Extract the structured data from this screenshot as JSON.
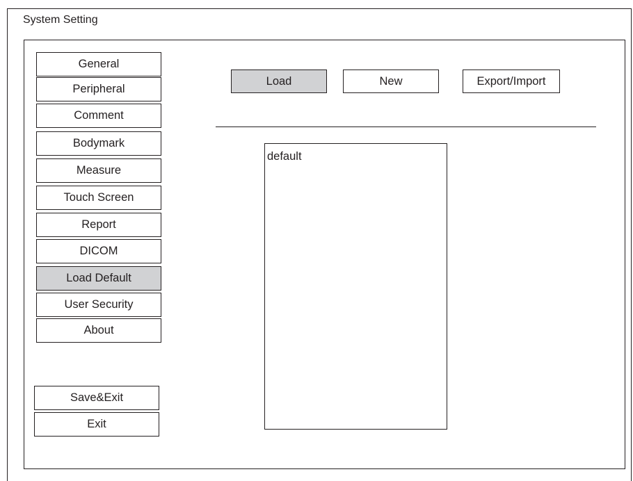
{
  "window": {
    "title": "System Setting"
  },
  "sidebar": {
    "items": [
      {
        "label": "General",
        "selected": false
      },
      {
        "label": "Peripheral",
        "selected": false
      },
      {
        "label": "Comment",
        "selected": false
      },
      {
        "label": "Bodymark",
        "selected": false
      },
      {
        "label": "Measure",
        "selected": false
      },
      {
        "label": "Touch Screen",
        "selected": false
      },
      {
        "label": "Report",
        "selected": false
      },
      {
        "label": "DICOM",
        "selected": false
      },
      {
        "label": "Load Default",
        "selected": true
      },
      {
        "label": "User Security",
        "selected": false
      },
      {
        "label": "About",
        "selected": false
      }
    ],
    "actions": {
      "save_exit": "Save&Exit",
      "exit": "Exit"
    }
  },
  "main": {
    "tabs": [
      {
        "label": "Load",
        "selected": true
      },
      {
        "label": "New",
        "selected": false
      },
      {
        "label": "Export/Import",
        "selected": false
      }
    ],
    "presets": {
      "items": [
        "default"
      ]
    }
  },
  "colors": {
    "selected_background": "#d1d2d4",
    "border": "#231f20",
    "background": "#ffffff"
  }
}
